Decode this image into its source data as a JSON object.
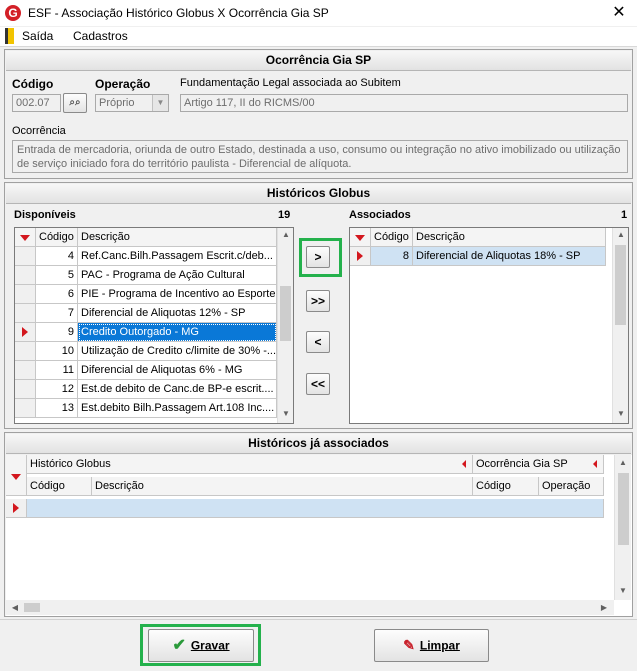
{
  "window": {
    "title": "ESF - Associação Histórico Globus X Ocorrência Gia SP",
    "icon": "G",
    "close": "✕"
  },
  "menu": {
    "items": [
      "Saída",
      "Cadastros"
    ]
  },
  "ocorrencia_panel": {
    "title": "Ocorrência Gia SP",
    "codigo_label": "Código",
    "codigo_value": "002.07",
    "operacao_label": "Operação",
    "operacao_value": "Próprio",
    "fundamentacao_label": "Fundamentação Legal associada ao Subitem",
    "fundamentacao_value": "Artigo 117, II do RICMS/00",
    "ocorrencia_label": "Ocorrência",
    "ocorrencia_text": "Entrada de mercadoria, oriunda de outro Estado, destinada a uso, consumo ou integração no ativo imobilizado ou utilização de serviço iniciado fora do território paulista - Diferencial de alíquota."
  },
  "historicos_panel": {
    "title": "Históricos Globus",
    "disponiveis_label": "Disponíveis",
    "disponiveis_count": "19",
    "associados_label": "Associados",
    "associados_count": "1",
    "col_codigo": "Código",
    "col_descricao": "Descrição",
    "disponiveis_rows": [
      {
        "codigo": "4",
        "descricao": "Ref.Canc.Bilh.Passagem Escrit.c/deb..."
      },
      {
        "codigo": "5",
        "descricao": "PAC - Programa de Ação Cultural"
      },
      {
        "codigo": "6",
        "descricao": "PIE - Programa de Incentivo ao Esporte"
      },
      {
        "codigo": "7",
        "descricao": "Diferencial de Aliquotas 12% - SP"
      },
      {
        "codigo": "9",
        "descricao": "Credito Outorgado - MG"
      },
      {
        "codigo": "10",
        "descricao": "Utilização de Credito c/limite de 30% -..."
      },
      {
        "codigo": "11",
        "descricao": "Diferencial de Aliquotas 6% - MG"
      },
      {
        "codigo": "12",
        "descricao": "Est.de debito de Canc.de BP-e escrit...."
      },
      {
        "codigo": "13",
        "descricao": "Est.debito Bilh.Passagem Art.108 Inc...."
      }
    ],
    "associados_rows": [
      {
        "codigo": "8",
        "descricao": "Diferencial de Aliquotas 18% - SP"
      }
    ],
    "btn_add": ">",
    "btn_add_all": ">>",
    "btn_remove": "<",
    "btn_remove_all": "<<"
  },
  "ja_associados_panel": {
    "title": "Históricos já associados",
    "group_historico": "Histórico Globus",
    "group_ocorrencia": "Ocorrência Gia SP",
    "col_codigo": "Código",
    "col_descricao": "Descrição",
    "col_codigo2": "Código",
    "col_operacao": "Operação"
  },
  "footer": {
    "gravar": "Gravar",
    "limpar": "Limpar"
  },
  "colors": {
    "highlight": "#24b14c",
    "selection": "#0a78d7",
    "accent_red": "#d3171e"
  }
}
